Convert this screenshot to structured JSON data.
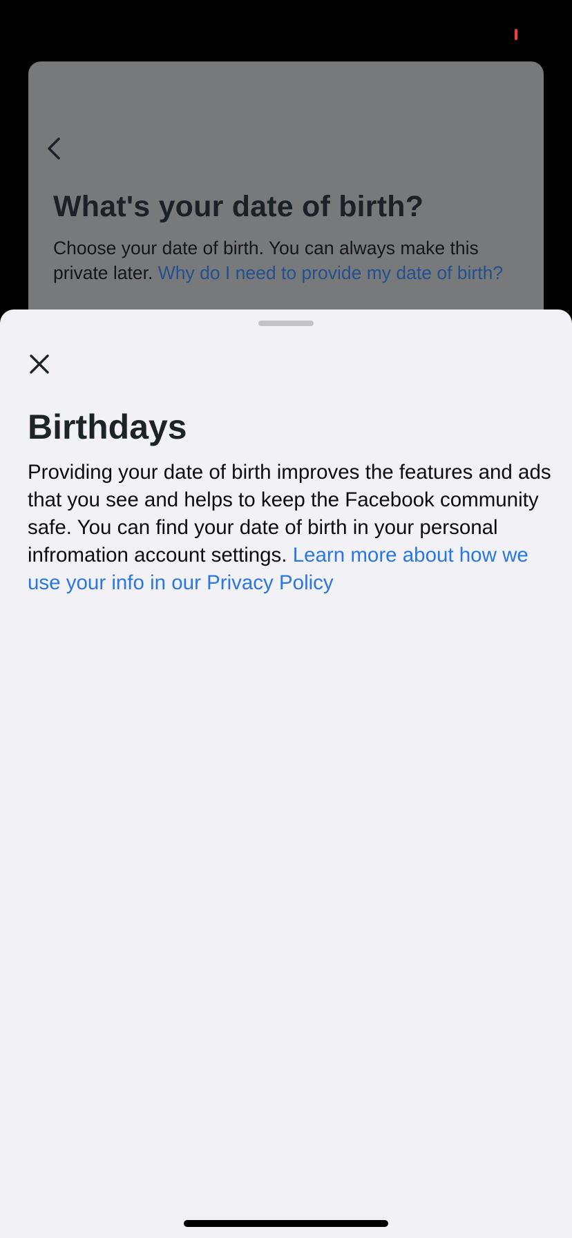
{
  "background_page": {
    "title": "What's your date of birth?",
    "description": "Choose your date of birth. You can always make this private later. ",
    "link_text": "Why do I need to provide my date of birth?",
    "back_icon": "chevron-left-icon"
  },
  "sheet": {
    "close_icon": "close-icon",
    "title": "Birthdays",
    "body_text": "Providing your date of birth improves the features and ads that you see and helps to keep the Facebook community safe. You can find your date of birth in your personal infromation account settings. ",
    "link_text": "Learn more about how we use your info in our Privacy Policy"
  },
  "colors": {
    "sheet_background": "#f2f2f6",
    "link": "#2a76e2",
    "dimmed_card": "#77797b"
  }
}
